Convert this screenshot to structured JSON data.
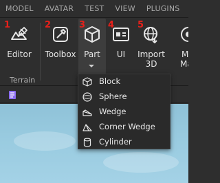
{
  "menu": {
    "tabs": [
      "MODEL",
      "AVATAR",
      "TEST",
      "VIEW",
      "PLUGINS"
    ]
  },
  "ribbon": {
    "group_label": "Terrain",
    "tools": [
      {
        "id": "editor",
        "number": "1",
        "label": "Editor",
        "icon": "terrain-editor-icon"
      },
      {
        "id": "toolbox",
        "number": "2",
        "label": "Toolbox",
        "icon": "toolbox-icon"
      },
      {
        "id": "part",
        "number": "3",
        "label": "Part",
        "icon": "part-cube-icon"
      },
      {
        "id": "ui",
        "number": "4",
        "label": "UI",
        "icon": "ui-icon"
      },
      {
        "id": "import3d",
        "number": "5",
        "label": "Import",
        "label2": "3D",
        "icon": "import-3d-icon"
      },
      {
        "id": "more",
        "label": "M",
        "label2": "Ma",
        "icon": "material-icon"
      }
    ]
  },
  "part_dropdown": {
    "items": [
      {
        "label": "Block",
        "icon": "block-icon"
      },
      {
        "label": "Sphere",
        "icon": "sphere-icon"
      },
      {
        "label": "Wedge",
        "icon": "wedge-icon"
      },
      {
        "label": "Corner Wedge",
        "icon": "corner-wedge-icon"
      },
      {
        "label": "Cylinder",
        "icon": "cylinder-icon"
      }
    ]
  },
  "colors": {
    "background": "#2e2e2e",
    "number_red": "#e8201a",
    "sky": "#99cbe0",
    "quick_access_icon": "#8b6cf0"
  }
}
